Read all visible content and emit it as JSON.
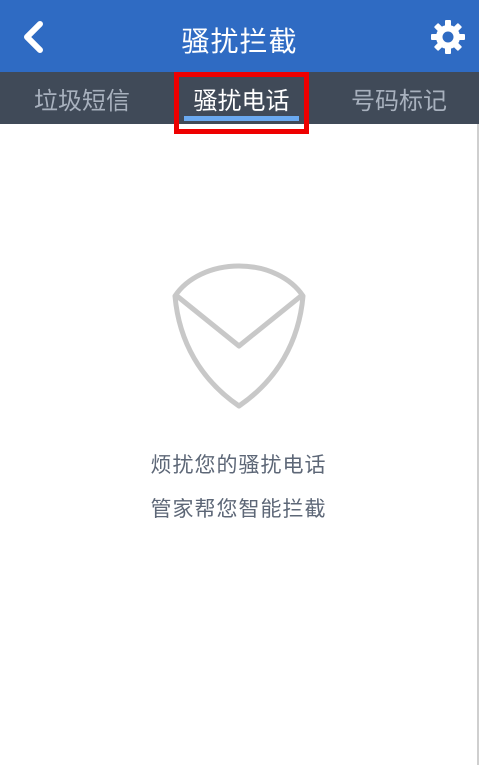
{
  "header": {
    "title": "骚扰拦截",
    "background_color": "#2f6bc3",
    "back_icon": "chevron-left-icon",
    "settings_icon": "gear-icon"
  },
  "tabs": [
    {
      "label": "垃圾短信",
      "active": false
    },
    {
      "label": "骚扰电话",
      "active": true
    },
    {
      "label": "号码标记",
      "active": false
    }
  ],
  "tabbar": {
    "background_color": "#404a58",
    "active_underline_color": "#6aa9f0",
    "highlight_color": "#ee0000"
  },
  "empty_state": {
    "icon": "shield-check-icon",
    "line1": "烦扰您的骚扰电话",
    "line2": "管家帮您智能拦截"
  }
}
